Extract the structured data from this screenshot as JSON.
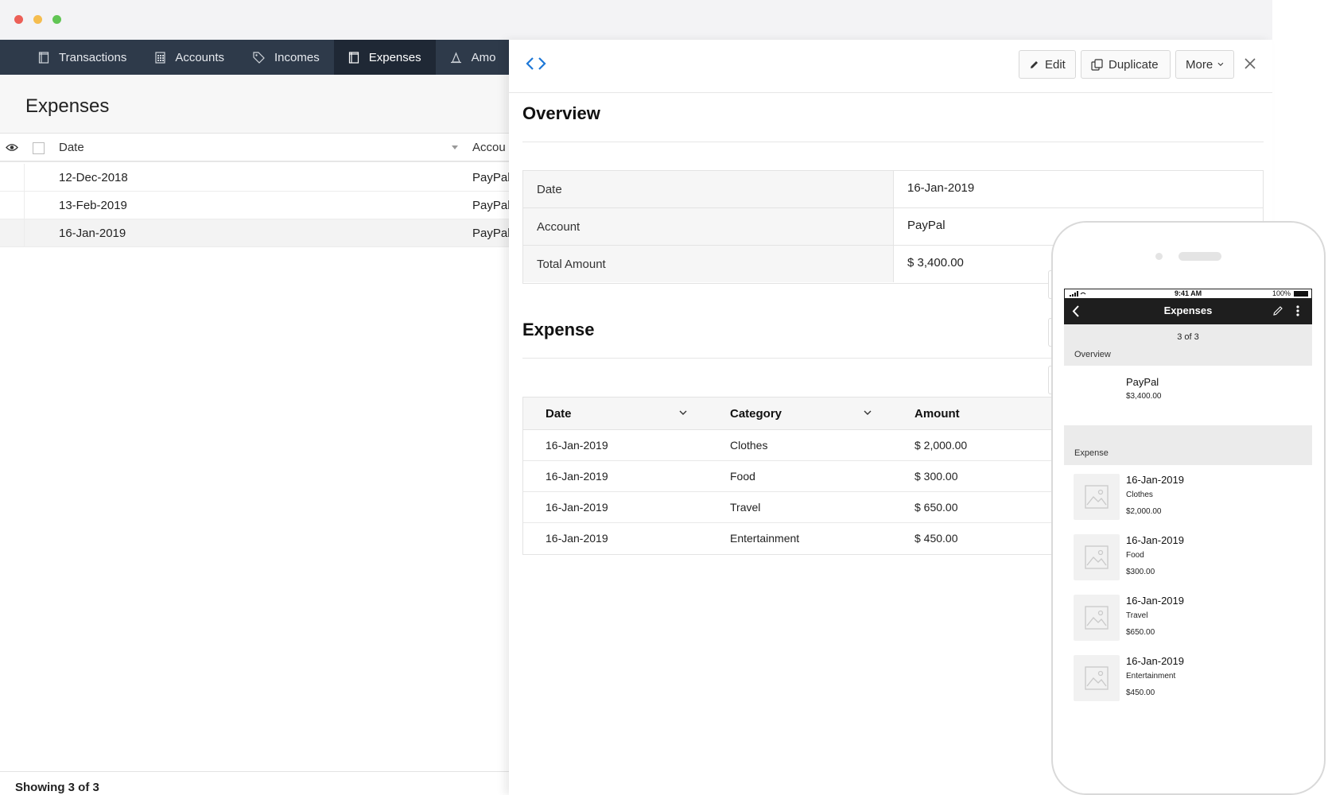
{
  "nav": {
    "tabs": [
      {
        "label": "Transactions",
        "icon": "receipt-icon"
      },
      {
        "label": "Accounts",
        "icon": "calculator-icon"
      },
      {
        "label": "Incomes",
        "icon": "tag-icon"
      },
      {
        "label": "Expenses",
        "icon": "receipt-icon",
        "active": true
      },
      {
        "label": "Amo",
        "icon": "scale-icon"
      }
    ]
  },
  "list": {
    "title": "Expenses",
    "columns": {
      "date": "Date",
      "account": "Accou"
    },
    "rows": [
      {
        "date": "12-Dec-2018",
        "account": "PayPal"
      },
      {
        "date": "13-Feb-2019",
        "account": "PayPal"
      },
      {
        "date": "16-Jan-2019",
        "account": "PayPal",
        "selected": true
      }
    ],
    "footer": "Showing 3 of 3"
  },
  "detail": {
    "toolbar": {
      "edit": "Edit",
      "duplicate": "Duplicate",
      "more": "More"
    },
    "overview_title": "Overview",
    "overview": [
      {
        "label": "Date",
        "value": "16-Jan-2019"
      },
      {
        "label": "Account",
        "value": "PayPal"
      },
      {
        "label": "Total Amount",
        "value": "$ 3,400.00"
      }
    ],
    "expense_title": "Expense",
    "expense_columns": {
      "date": "Date",
      "category": "Category",
      "amount": "Amount"
    },
    "expenses": [
      {
        "date": "16-Jan-2019",
        "category": "Clothes",
        "amount": "$ 2,000.00"
      },
      {
        "date": "16-Jan-2019",
        "category": "Food",
        "amount": "$ 300.00"
      },
      {
        "date": "16-Jan-2019",
        "category": "Travel",
        "amount": "$ 650.00"
      },
      {
        "date": "16-Jan-2019",
        "category": "Entertainment",
        "amount": "$ 450.00"
      }
    ]
  },
  "phone": {
    "time": "9:41 AM",
    "battery": "100%",
    "title": "Expenses",
    "count": "3 of 3",
    "overview_label": "Overview",
    "account": "PayPal",
    "total": "$3,400.00",
    "expense_label": "Expense",
    "items": [
      {
        "date": "16-Jan-2019",
        "category": "Clothes",
        "amount": "$2,000.00"
      },
      {
        "date": "16-Jan-2019",
        "category": "Food",
        "amount": "$300.00"
      },
      {
        "date": "16-Jan-2019",
        "category": "Travel",
        "amount": "$650.00"
      },
      {
        "date": "16-Jan-2019",
        "category": "Entertainment",
        "amount": "$450.00"
      }
    ]
  },
  "colors": {
    "nav_bg": "#2e3a4a",
    "nav_active": "#1f2835",
    "accent": "#1e78d7"
  }
}
